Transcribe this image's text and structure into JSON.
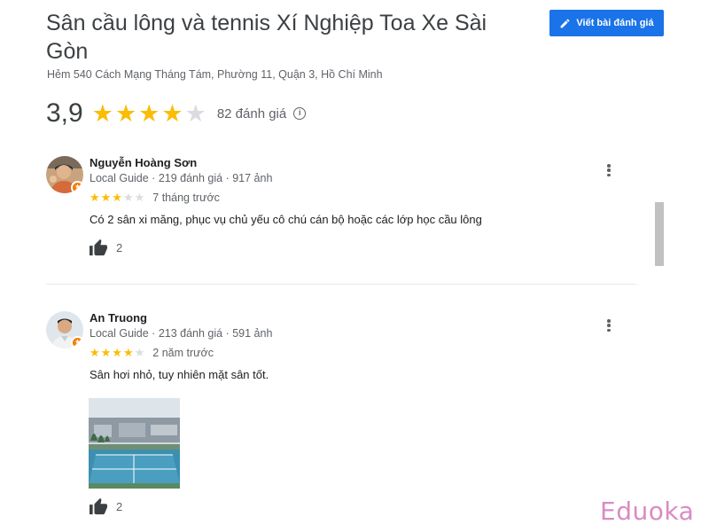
{
  "place": {
    "title": "Sân cầu lông và tennis Xí Nghiệp Toa Xe Sài Gòn",
    "address": "Hẻm 540 Cách Mạng Tháng Tám, Phường 11, Quận 3, Hồ Chí Minh",
    "rating": "3,9",
    "rating_value": 3.9,
    "stars_filled": 4,
    "review_count": "82 đánh giá",
    "info_icon": "info-icon"
  },
  "write_review_button": {
    "label": "Viết bài đánh giá",
    "icon": "pencil-icon",
    "color": "#1a73e8"
  },
  "reviews": [
    {
      "name": "Nguyễn Hoàng Sơn",
      "guide": "Local Guide · 219 đánh giá · 917 ảnh",
      "stars": 3,
      "time": "7 tháng trước",
      "text": "Có 2 sân xi măng, phục vụ chủ yếu cô chú cán bộ hoặc các lớp học cầu lông",
      "likes": "2"
    },
    {
      "name": "An Truong",
      "guide": "Local Guide · 213 đánh giá · 591 ảnh",
      "stars": 4,
      "time": "2 năm trước",
      "text": "Sân hơi nhỏ, tuy nhiên mặt sân tốt.",
      "likes": "2"
    }
  ],
  "watermark": "Eduoka",
  "colors": {
    "star": "#fbbc04",
    "star_empty": "#dadce0",
    "guide_badge": "#f57c00",
    "watermark": "#d98bc4"
  }
}
